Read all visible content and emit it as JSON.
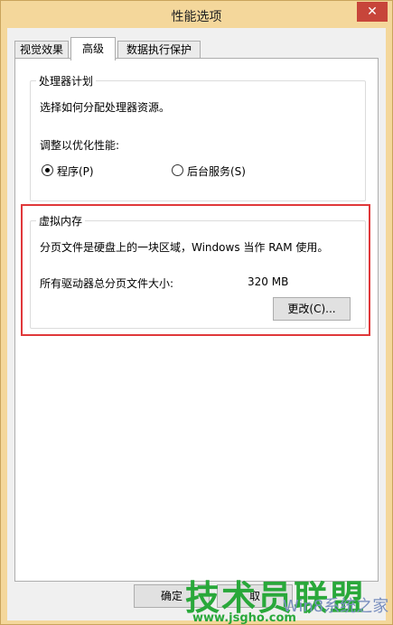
{
  "window": {
    "title": "性能选项",
    "close_glyph": "✕"
  },
  "tabs": [
    {
      "label": "视觉效果"
    },
    {
      "label": "高级"
    },
    {
      "label": "数据执行保护"
    }
  ],
  "processor": {
    "group_title": "处理器计划",
    "description": "选择如何分配处理器资源。",
    "adjust_label": "调整以优化性能:",
    "options": [
      {
        "label": "程序(P)",
        "selected": true
      },
      {
        "label": "后台服务(S)",
        "selected": false
      }
    ]
  },
  "virtual_memory": {
    "group_title": "虚拟内存",
    "description": "分页文件是硬盘上的一块区域，Windows 当作 RAM 使用。",
    "total_label": "所有驱动器总分页文件大小:",
    "total_value": "320 MB",
    "change_button": "更改(C)..."
  },
  "footer": {
    "ok_button": "确定",
    "cancel_button_partial": "取"
  },
  "watermark": {
    "brand": "技术员联盟",
    "url": "www.jsgho.com",
    "win_text": "Win8系统之家"
  },
  "colors": {
    "highlight": "#e0383a",
    "window_frame": "#f4d79b",
    "close_button": "#c7453a",
    "watermark_green": "#29a83a"
  }
}
